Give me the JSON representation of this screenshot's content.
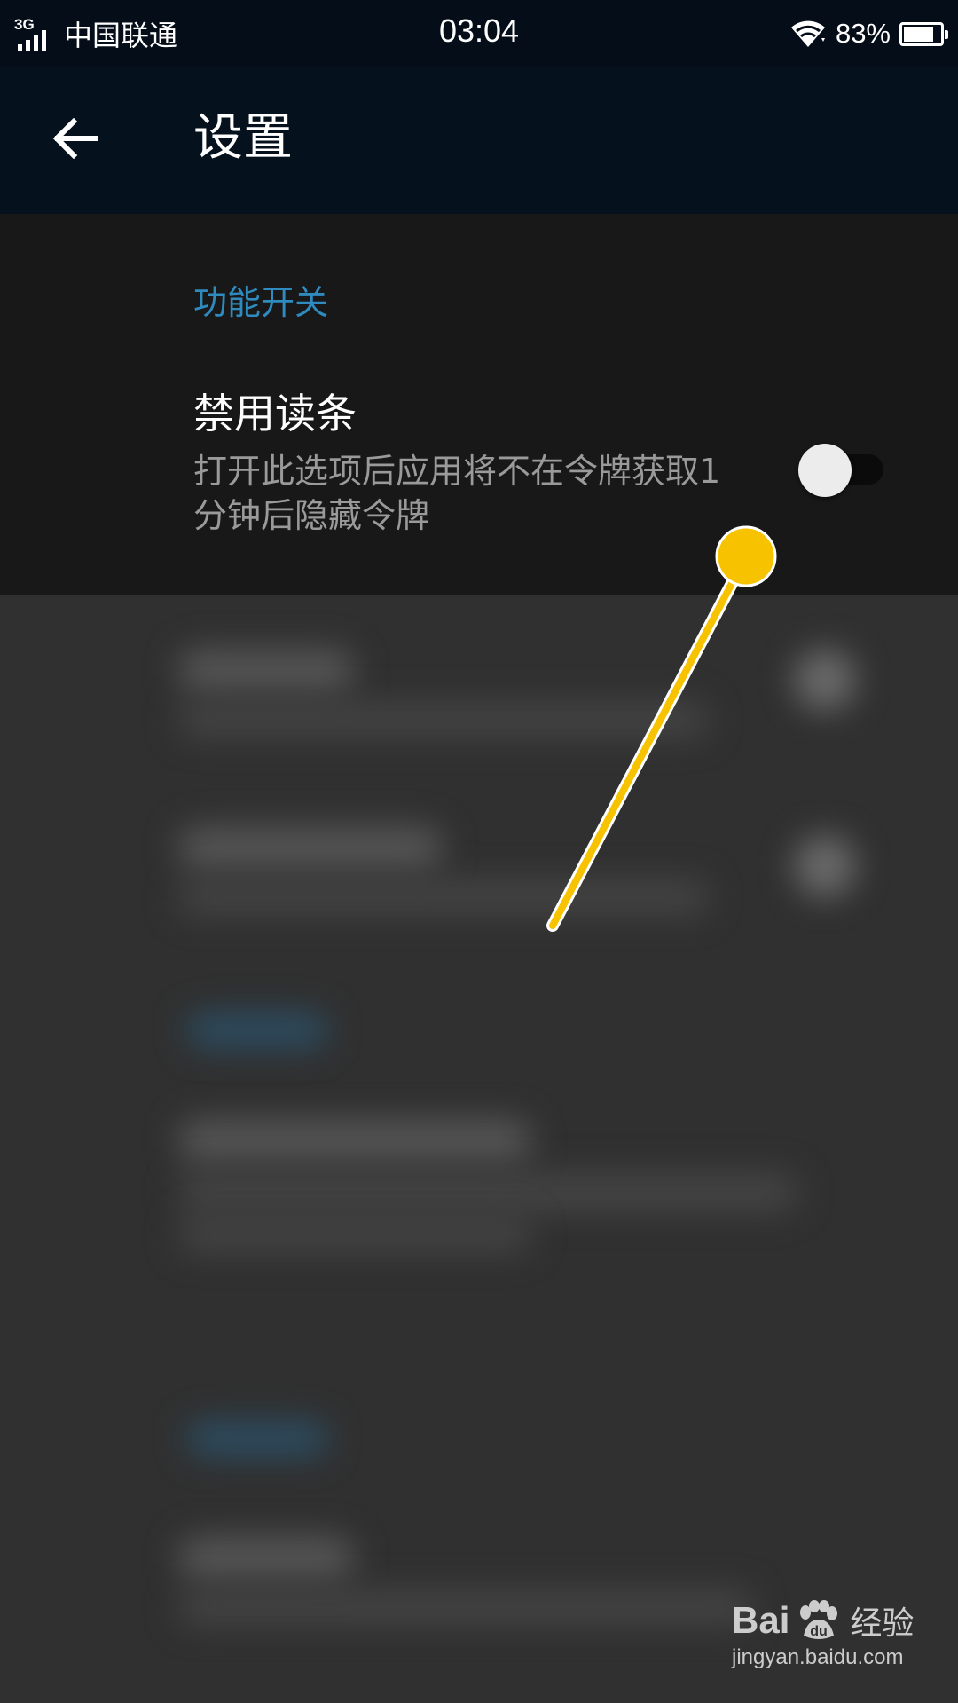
{
  "status_bar": {
    "network_type": "3G",
    "carrier": "中国联通",
    "time": "03:04",
    "battery_percent": "83%",
    "battery_level": 0.83,
    "icons": [
      "signal-icon",
      "wifi-icon",
      "battery-icon"
    ]
  },
  "app_bar": {
    "back_icon": "arrow-left-icon",
    "title": "设置"
  },
  "settings": {
    "section_title": "功能开关",
    "items": [
      {
        "title": "禁用读条",
        "description": "打开此选项后应用将不在令牌获取1分钟后隐藏令牌",
        "enabled": false
      }
    ]
  },
  "colors": {
    "status_bar_bg": "#040d18",
    "app_bar_bg": "#06111e",
    "panel_bg": "#181818",
    "accent": "#2f8bbf",
    "annotation": "#f7c200"
  },
  "watermark": {
    "logo_text": "Bai",
    "logo_text_end": "经验",
    "url": "jingyan.baidu.com"
  }
}
